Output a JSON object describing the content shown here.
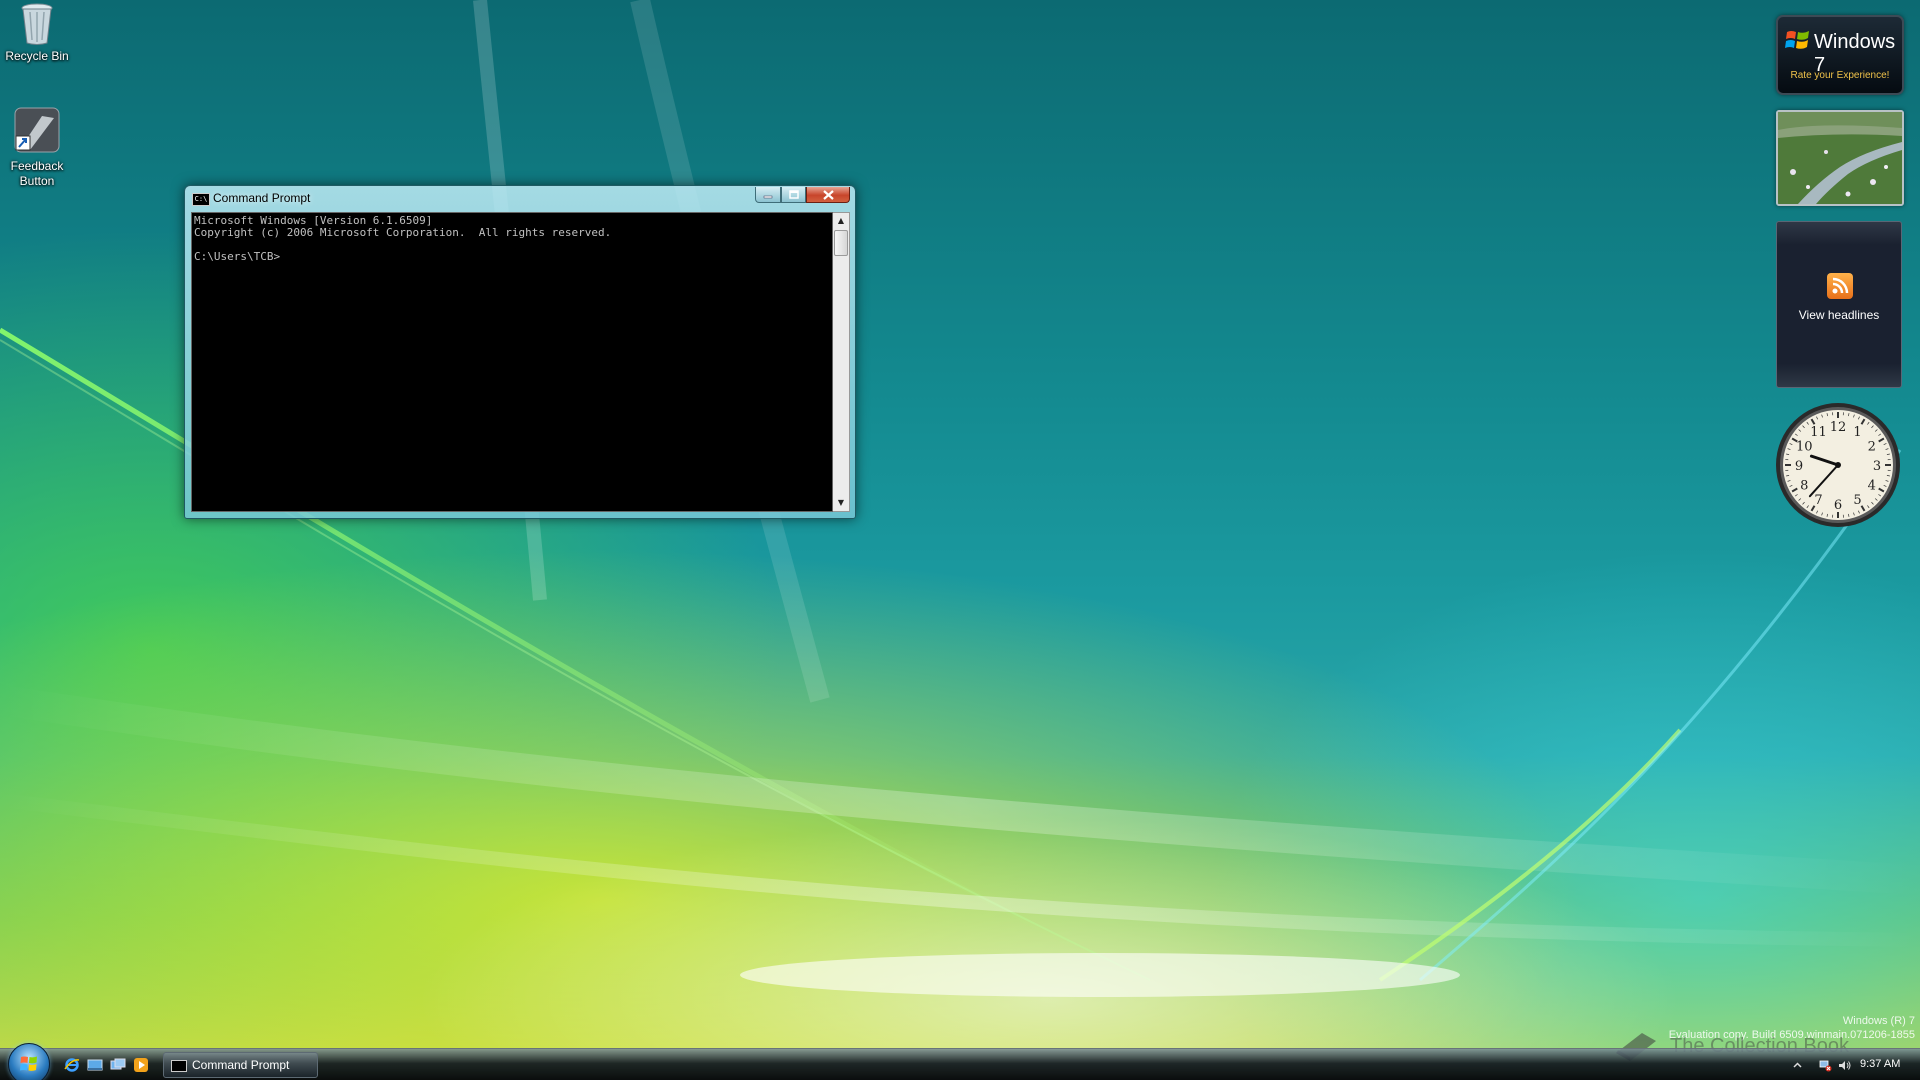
{
  "desktop": {
    "icons": [
      {
        "label": "Recycle Bin",
        "icon": "recycle-bin-icon"
      },
      {
        "label": "Feedback\nButton",
        "icon": "feedback-icon"
      }
    ]
  },
  "cmd_window": {
    "title": "Command Prompt",
    "icon_text": "C:\\",
    "console_text": "Microsoft Windows [Version 6.1.6509]\nCopyright (c) 2006 Microsoft Corporation.  All rights reserved.\n\nC:\\Users\\TCB>",
    "buttons": {
      "minimize": "minimize-icon",
      "maximize": "maximize-icon",
      "close": "close-icon"
    }
  },
  "gadgets": {
    "windows7": {
      "title": "Windows 7",
      "subtitle": "Rate your Experience!"
    },
    "feed": {
      "label": "View headlines",
      "icon": "rss-feed-icon"
    },
    "clock": {
      "numbers": [
        "12",
        "1",
        "2",
        "3",
        "4",
        "5",
        "6",
        "7",
        "8",
        "9",
        "10",
        "11"
      ],
      "time": "9:37"
    }
  },
  "watermark": {
    "line1": "Windows (R) 7",
    "line2": "Evaluation copy. Build 6509.winmain.071206-1855",
    "brand": "The Collection Book"
  },
  "taskbar": {
    "start": "start-orb",
    "quick_launch": [
      "internet-explorer-icon",
      "show-desktop-icon",
      "switch-windows-icon",
      "media-player-icon"
    ],
    "tasks": [
      {
        "label": "Command Prompt",
        "icon": "cmd-icon"
      }
    ],
    "tray": {
      "time": "9:37 AM"
    }
  },
  "colors": {
    "console_bg": "#000000",
    "console_fg": "#c0c0c0",
    "feed_icon": "#f08a24",
    "win7_subtitle": "#f0c24a"
  }
}
